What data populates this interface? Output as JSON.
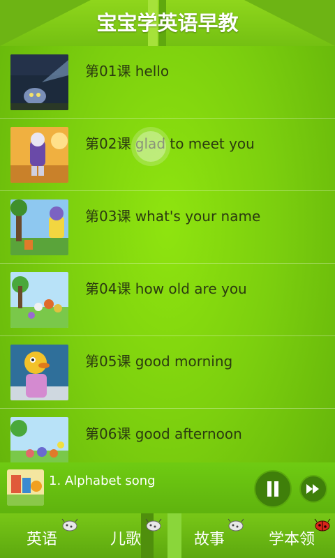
{
  "header": {
    "title": "宝宝学英语早教"
  },
  "lessons": [
    {
      "label": "第01课 hello",
      "thumb_icon": "ghost-dark-scene-thumbnail"
    },
    {
      "label": "第02课 glad to meet you",
      "thumb_icon": "cartoon-cat-thumbnail"
    },
    {
      "label": "第03课 what's your name",
      "thumb_icon": "cartoon-forest-thumbnail"
    },
    {
      "label": "第04课 how old are you",
      "thumb_icon": "cartoon-friends-thumbnail"
    },
    {
      "label": "第05课 good morning",
      "thumb_icon": "cartoon-duck-thumbnail"
    },
    {
      "label": "第06课 good afternoon",
      "thumb_icon": "cartoon-group-thumbnail"
    }
  ],
  "player": {
    "song": "1. Alphabet song",
    "state": "playing"
  },
  "tabs": [
    {
      "label": "英语",
      "icon": "bug-icon"
    },
    {
      "label": "儿歌",
      "icon": "bug-icon"
    },
    {
      "label": "故事",
      "icon": "bug-icon"
    },
    {
      "label": "学本领",
      "icon": "ladybug-icon"
    }
  ],
  "colors": {
    "accent": "#7ccf0e",
    "text": "#2b3a10",
    "dark_green": "#3f7f0a"
  }
}
